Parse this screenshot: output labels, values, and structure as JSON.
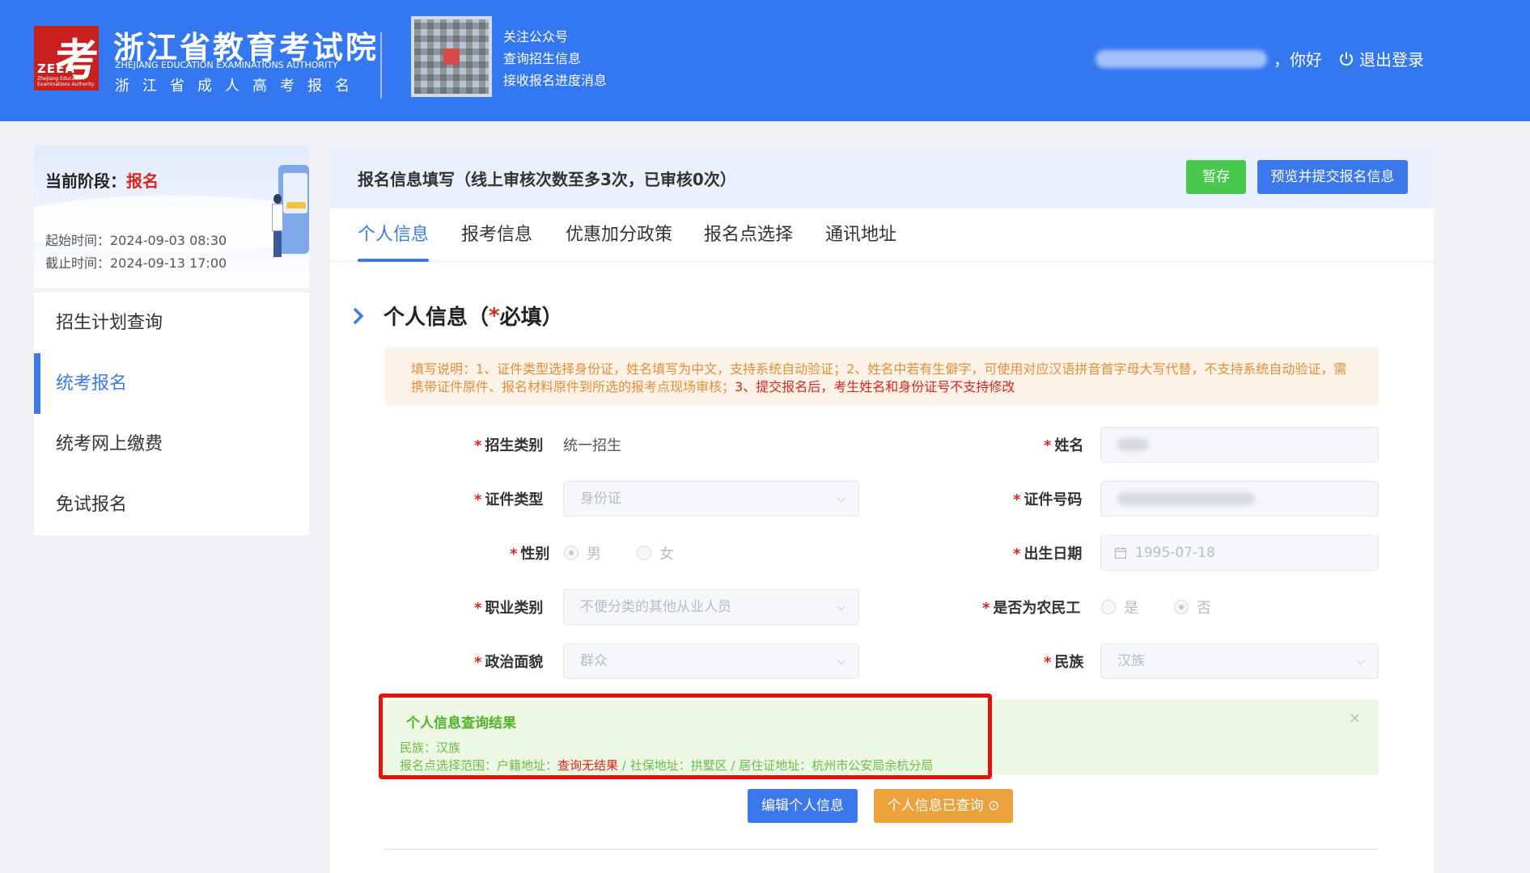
{
  "header": {
    "logo_glyph": "考",
    "logo_abbr": "ZEEA",
    "logo_abbr_sub": "Zhejiang Education Examinations Authority",
    "org_name": "浙江省教育考试院",
    "org_en": "ZHEJIANG EDUCATION EXAMINATIONS AUTHORITY",
    "org_sub": "浙江省成人高考报名",
    "qr_line1": "关注公众号",
    "qr_line2": "查询招生信息",
    "qr_line3": "接收报名进度消息",
    "greeting": "，你好",
    "logout_label": "退出登录"
  },
  "sidebar": {
    "stage_label": "当前阶段：",
    "stage_value": "报名",
    "start_time": "起始时间：2024-09-03 08:30",
    "end_time": "截止时间：2024-09-13 17:00",
    "items": [
      {
        "label": "招生计划查询"
      },
      {
        "label": "统考报名"
      },
      {
        "label": "统考网上缴费"
      },
      {
        "label": "免试报名"
      }
    ]
  },
  "main": {
    "title": "报名信息填写（线上审核次数至多3次，已审核0次）",
    "save_label": "暂存",
    "submit_label": "预览并提交报名信息",
    "tabs": [
      {
        "label": "个人信息"
      },
      {
        "label": "报考信息"
      },
      {
        "label": "优惠加分政策"
      },
      {
        "label": "报名点选择"
      },
      {
        "label": "通讯地址"
      }
    ],
    "section_title_a": "个人信息（",
    "section_title_req": "*",
    "section_title_b": "必填）",
    "notice_part1": "填写说明：1、证件类型选择身份证，姓名填写为中文，支持系统自动验证；2、姓名中若有生僻字，可使用对应汉语拼音首字母大写代替，不支持系统自动验证，需携带证件原件、报名材料原件到所选的报考点现场审核；",
    "notice_part2": "3、提交报名后，考生姓名和身份证号不支持修改"
  },
  "form": {
    "enroll_type_label": "招生类别",
    "enroll_type_value": "统一招生",
    "name_label": "姓名",
    "id_type_label": "证件类型",
    "id_type_value": "身份证",
    "id_number_label": "证件号码",
    "gender_label": "性别",
    "gender_male": "男",
    "gender_female": "女",
    "birth_label": "出生日期",
    "birth_value": "1995-07-18",
    "occupation_label": "职业类别",
    "occupation_value": "不便分类的其他从业人员",
    "migrant_label": "是否为农民工",
    "migrant_yes": "是",
    "migrant_no": "否",
    "political_label": "政治面貌",
    "political_value": "群众",
    "ethnicity_label": "民族",
    "ethnicity_value": "汉族"
  },
  "result": {
    "title": "个人信息查询结果",
    "ethnicity_line": "民族：汉族",
    "scope_prefix": "报名点选择范围：户籍地址：",
    "scope_no_result": "查询无结果",
    "scope_suffix": " / 社保地址：拱墅区 / 居住证地址：杭州市公安局余杭分局",
    "close_glyph": "×"
  },
  "actions": {
    "edit_label": "编辑个人信息",
    "queried_label": "个人信息已查询 ⊙"
  },
  "colors": {
    "header_bg": "#3377f1",
    "accent": "#3c7ae6",
    "required": "#d9251f",
    "save_button": "#48c94e",
    "queried_button": "#eca23c",
    "highlight_frame": "#e3120b"
  }
}
